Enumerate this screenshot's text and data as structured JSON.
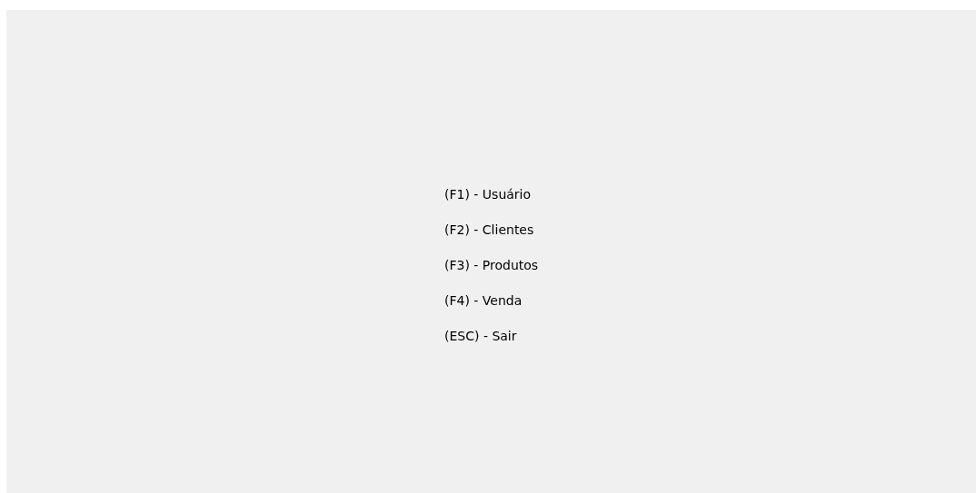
{
  "menu_options": [
    {
      "label": "(F1) - Usuário"
    },
    {
      "label": "(F2) - Clientes"
    },
    {
      "label": "(F3) - Produtos"
    },
    {
      "label": "(F4) - Venda"
    },
    {
      "label": "(ESC) - Sair"
    }
  ]
}
